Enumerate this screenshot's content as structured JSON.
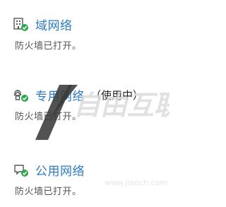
{
  "networks": [
    {
      "icon": "domain-network-icon",
      "title": "域网络",
      "suffix": "",
      "status": "防火墙已打开。"
    },
    {
      "icon": "private-network-icon",
      "title": "专用网络",
      "suffix": "（使用中）",
      "status": "防火墙已打开。"
    },
    {
      "icon": "public-network-icon",
      "title": "公用网络",
      "suffix": "",
      "status": "防火墙已打开。"
    }
  ],
  "watermark": {
    "brand": "X自由互联",
    "url": "www.jiaoch.com"
  },
  "colors": {
    "link": "#2c7bc4",
    "status_check": "#2aa84a",
    "watermark_dark": "#3a3a3a",
    "watermark_light": "#dcdcdc"
  }
}
